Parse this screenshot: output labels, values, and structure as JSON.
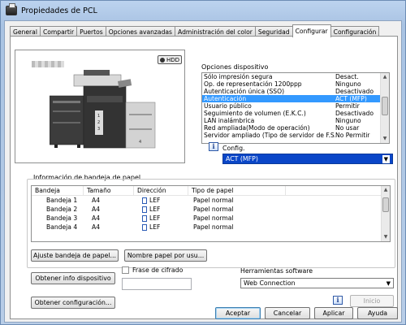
{
  "window": {
    "title": "Propiedades de PCL"
  },
  "tabs": [
    {
      "label": "General"
    },
    {
      "label": "Compartir"
    },
    {
      "label": "Puertos"
    },
    {
      "label": "Opciones avanzadas"
    },
    {
      "label": "Administración del color"
    },
    {
      "label": "Seguridad"
    },
    {
      "label": "Configurar"
    },
    {
      "label": "Configuración"
    }
  ],
  "active_tab": "Configurar",
  "preview": {
    "hdd_badge": "HDD"
  },
  "device_options": {
    "label": "Opciones dispositivo",
    "rows": [
      {
        "name": "Sólo impresión segura",
        "value": "Desact."
      },
      {
        "name": "Op. de representación 1200ppp",
        "value": "Ninguno"
      },
      {
        "name": "Autenticación única (SSO)",
        "value": "Desactivado"
      },
      {
        "name": "Autenticación",
        "value": "ACT (MFP)",
        "selected": true
      },
      {
        "name": "Usuario público",
        "value": "Permitir"
      },
      {
        "name": "Seguimiento de volumen (E.K.C.)",
        "value": "Desactivado"
      },
      {
        "name": "LAN inalámbrica",
        "value": "Ninguno"
      },
      {
        "name": "Red ampliada(Modo de operación)",
        "value": "No usar"
      },
      {
        "name": "Servidor ampliado (Tipo de servidor de F.S.)",
        "value": "No Permitir"
      }
    ],
    "scroll_fraction": 0.45
  },
  "config": {
    "label": "Config.",
    "value": "ACT (MFP)",
    "info_icon": "i"
  },
  "paper_tray": {
    "label": "Información de bandeja de papel",
    "headers": [
      "Bandeja",
      "Tamaño",
      "Dirección",
      "Tipo de papel"
    ],
    "rows": [
      {
        "tray": "Bandeja 1",
        "size": "A4",
        "direction": "LEF",
        "type": "Papel normal"
      },
      {
        "tray": "Bandeja 2",
        "size": "A4",
        "direction": "LEF",
        "type": "Papel normal"
      },
      {
        "tray": "Bandeja 3",
        "size": "A4",
        "direction": "LEF",
        "type": "Papel normal"
      },
      {
        "tray": "Bandeja 4",
        "size": "A4",
        "direction": "LEF",
        "type": "Papel normal"
      }
    ]
  },
  "buttons": {
    "tray_settings": "Ajuste bandeja de papel...",
    "paper_name": "Nombre papel por usu...",
    "get_device_info": "Obtener info dispositivo",
    "get_config": "Obtener configuración...",
    "start": "Inicio",
    "ok": "Aceptar",
    "cancel": "Cancelar",
    "apply": "Aplicar",
    "help": "Ayuda"
  },
  "passphrase": {
    "label": "Frase de cifrado",
    "checked": false,
    "value": ""
  },
  "software_tools": {
    "label": "Herramientas software",
    "value": "Web Connection",
    "info_icon": "i"
  }
}
